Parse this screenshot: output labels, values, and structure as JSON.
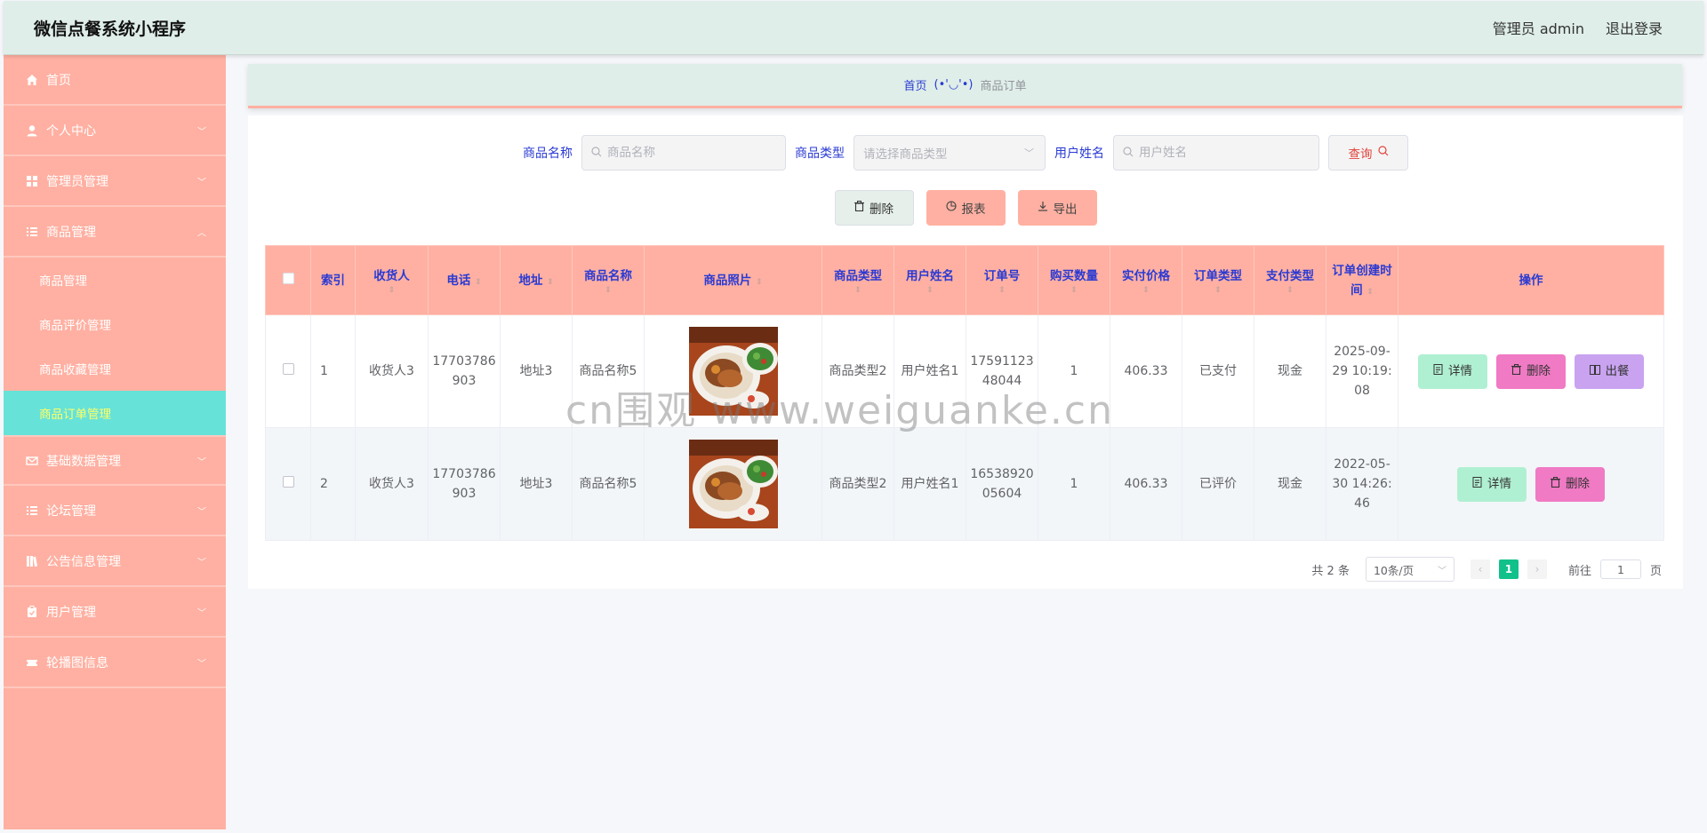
{
  "header": {
    "title": "微信点餐系统小程序",
    "admin_label": "管理员 admin",
    "logout_label": "退出登录"
  },
  "sidebar": {
    "items": [
      {
        "label": "首页",
        "icon": "home-icon"
      },
      {
        "label": "个人中心",
        "icon": "user-icon"
      },
      {
        "label": "管理员管理",
        "icon": "grid-icon"
      },
      {
        "label": "商品管理",
        "icon": "list-icon"
      },
      {
        "label": "基础数据管理",
        "icon": "mail-icon"
      },
      {
        "label": "论坛管理",
        "icon": "list-icon"
      },
      {
        "label": "公告信息管理",
        "icon": "book-icon"
      },
      {
        "label": "用户管理",
        "icon": "clipboard-icon"
      },
      {
        "label": "轮播图信息",
        "icon": "ticket-icon"
      }
    ],
    "sub_items": [
      {
        "label": "商品管理"
      },
      {
        "label": "商品评价管理"
      },
      {
        "label": "商品收藏管理"
      },
      {
        "label": "商品订单管理"
      }
    ]
  },
  "breadcrumb": {
    "home": "首页",
    "separator": "(•'◡'•)",
    "current": "商品订单"
  },
  "search": {
    "product_name_label": "商品名称",
    "product_name_placeholder": "商品名称",
    "product_type_label": "商品类型",
    "product_type_placeholder": "请选择商品类型",
    "user_name_label": "用户姓名",
    "user_name_placeholder": "用户姓名",
    "query_label": "查询"
  },
  "actions": {
    "delete_label": "删除",
    "report_label": "报表",
    "export_label": "导出"
  },
  "table": {
    "columns": [
      "索引",
      "收货人",
      "电话",
      "地址",
      "商品名称",
      "商品照片",
      "商品类型",
      "用户姓名",
      "订单号",
      "购买数量",
      "实付价格",
      "订单类型",
      "支付类型",
      "订单创建时间",
      "操作"
    ],
    "rows": [
      {
        "index": "1",
        "receiver": "收货人3",
        "phone": "17703786903",
        "address": "地址3",
        "product_name": "商品名称5",
        "product_type": "商品类型2",
        "user_name": "用户姓名1",
        "order_no": "1759112348044",
        "quantity": "1",
        "price": "406.33",
        "order_type": "已支付",
        "pay_type": "现金",
        "created": "2025-09-29 10:19:08"
      },
      {
        "index": "2",
        "receiver": "收货人3",
        "phone": "17703786903",
        "address": "地址3",
        "product_name": "商品名称5",
        "product_type": "商品类型2",
        "user_name": "用户姓名1",
        "order_no": "1653892005604",
        "quantity": "1",
        "price": "406.33",
        "order_type": "已评价",
        "pay_type": "现金",
        "created": "2022-05-30 14:26:46"
      }
    ],
    "ops": {
      "detail": "详情",
      "delete": "删除",
      "serve": "出餐"
    }
  },
  "pagination": {
    "total": "共 2 条",
    "page_size": "10条/页",
    "current_page": "1",
    "goto_label": "前往",
    "goto_value": "1",
    "page_unit": "页"
  },
  "watermark": "cn围观 www.weiguanke.cn",
  "colors": {
    "header_bg": "#dfeee8",
    "sidebar_bg": "#ffb0a2",
    "active_bg": "#66e2d8",
    "active_text": "#ffff66",
    "label_blue": "#2a3ad3",
    "page_active": "#12c18a"
  }
}
